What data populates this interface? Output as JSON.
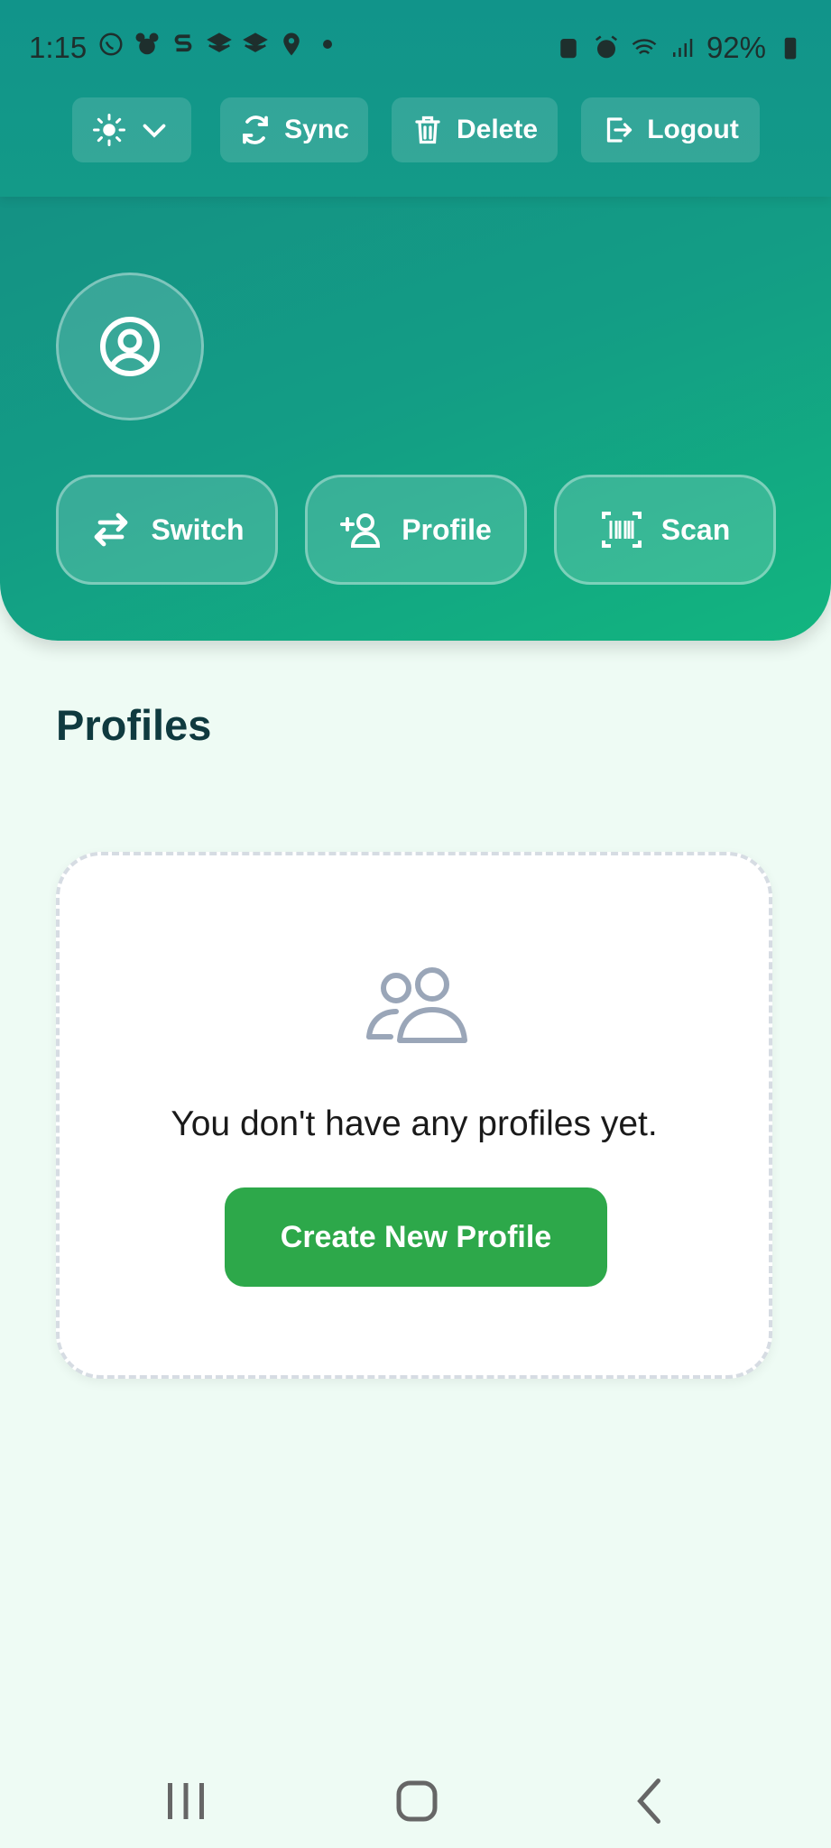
{
  "status_bar": {
    "time": "1:15",
    "battery": "92%"
  },
  "toolbar": {
    "theme_icon": "sun-icon",
    "sync_label": "Sync",
    "delete_label": "Delete",
    "logout_label": "Logout"
  },
  "hero": {
    "avatar_icon": "user-circle-icon",
    "actions": [
      {
        "label": "Switch",
        "icon": "swap-arrows-icon"
      },
      {
        "label": "Profile",
        "icon": "add-user-icon"
      },
      {
        "label": "Scan",
        "icon": "barcode-scan-icon"
      }
    ]
  },
  "main": {
    "section_title": "Profiles",
    "empty_state": {
      "icon": "users-icon",
      "message": "You don't have any profiles yet.",
      "button_label": "Create New Profile"
    }
  },
  "colors": {
    "header": "#11948a",
    "hero_end": "#12b57f",
    "background": "#eefbf4",
    "primary_button": "#2da84a",
    "title": "#0f3a3f"
  }
}
